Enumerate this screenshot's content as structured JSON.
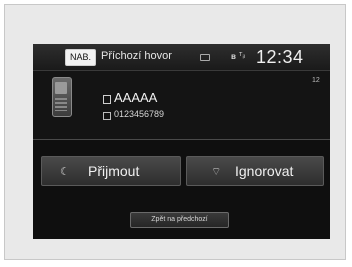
{
  "status_bar": {
    "nav_label": "NAB.",
    "title": "Příchozí hovor",
    "clock": "12:34",
    "bt_symbol": "ʙ",
    "signal_symbol": "ᵀᵢₗ"
  },
  "caller": {
    "name": "AAAAA",
    "number": "0123456789",
    "signal_count": "12"
  },
  "actions": {
    "accept_label": "Přijmout",
    "ignore_label": "Ignorovat",
    "accept_icon": "☾",
    "ignore_icon": "⌔",
    "back_label": "Zpět na předchozí"
  },
  "icons": {
    "phone": "mobile-phone-icon",
    "mail": "mail-icon",
    "bluetooth": "bluetooth-icon",
    "signal": "signal-icon"
  }
}
